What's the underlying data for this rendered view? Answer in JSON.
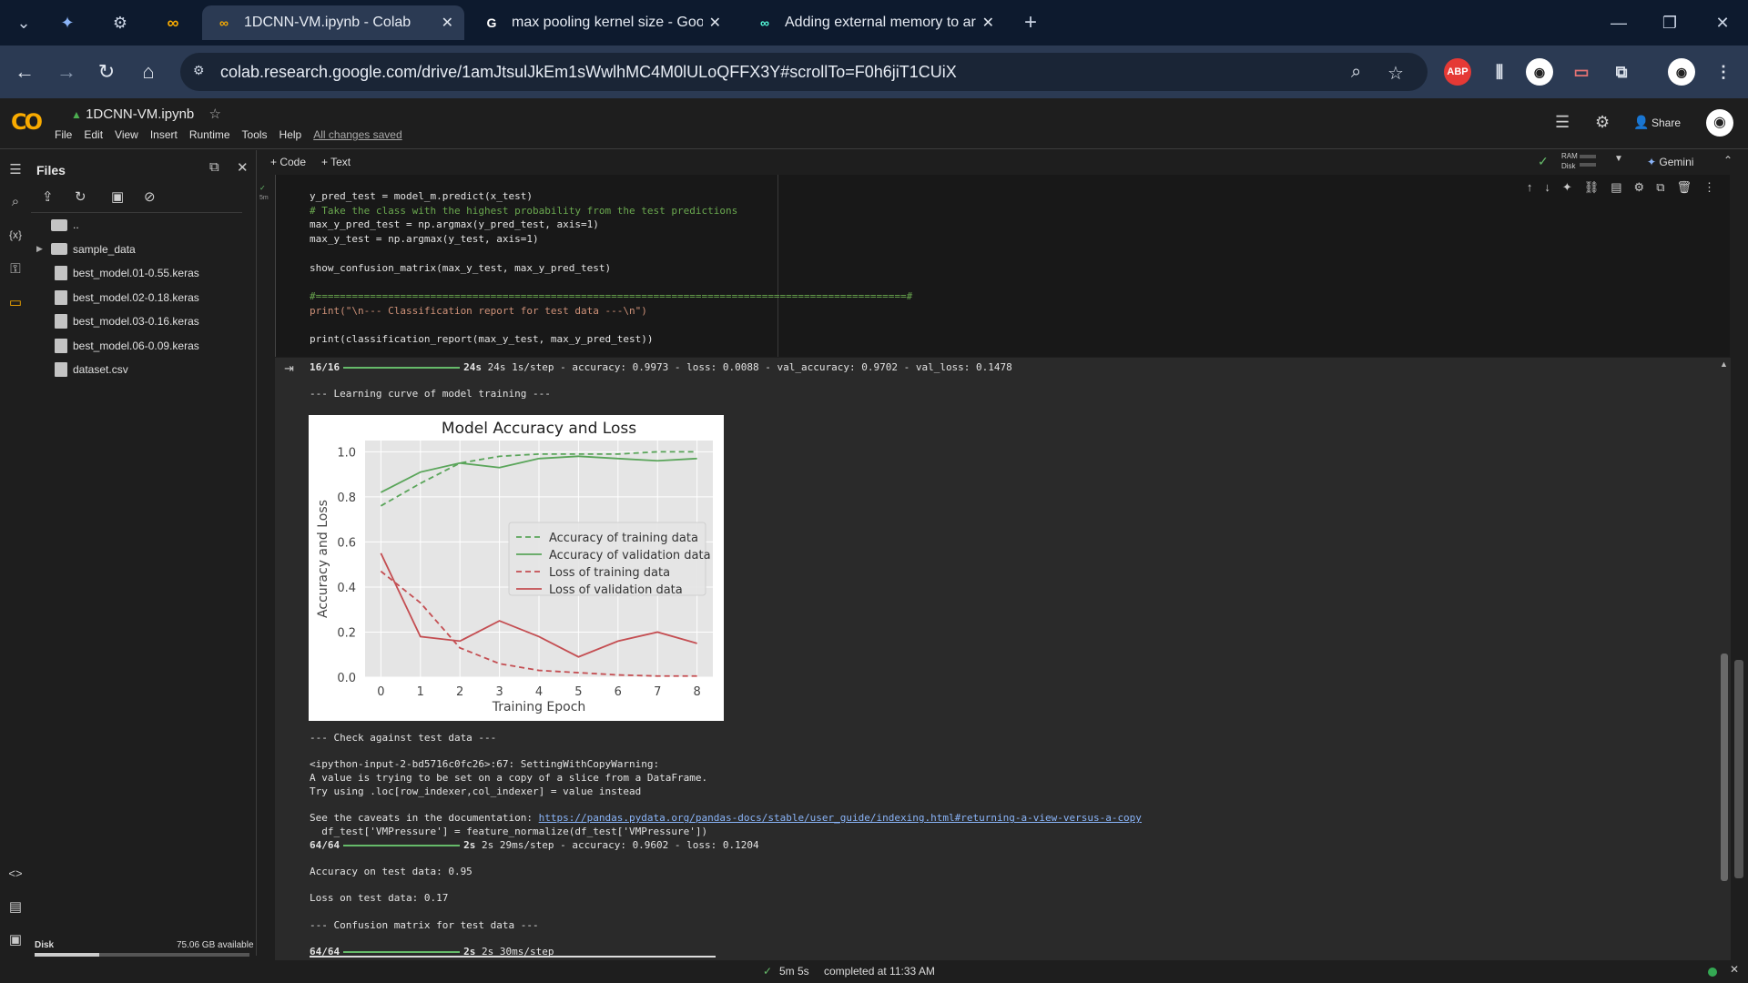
{
  "browser": {
    "tabs": [
      {
        "title": "1DCNN-VM.ipynb - Colab",
        "active": true
      },
      {
        "title": "max pooling kernel size - Goog",
        "active": false
      },
      {
        "title": "Adding external memory to ard",
        "active": false
      }
    ],
    "url": "colab.research.google.com/drive/1amJtsulJkEm1sWwlhMC4M0lULoQFFX3Y#scrollTo=F0h6jiT1CUiX",
    "ext_abp": "ABP"
  },
  "colab": {
    "logo": "CO",
    "notebook_title": "1DCNN-VM.ipynb",
    "menu": [
      "File",
      "Edit",
      "View",
      "Insert",
      "Runtime",
      "Tools",
      "Help"
    ],
    "saved_status": "All changes saved",
    "share_label": "Share",
    "toolbar": {
      "code": "+ Code",
      "text": "+ Text",
      "ram": "RAM",
      "disk": "Disk",
      "gemini": "Gemini"
    }
  },
  "files_panel": {
    "title": "Files",
    "items": [
      {
        "name": "..",
        "type": "folder-up"
      },
      {
        "name": "sample_data",
        "type": "folder"
      },
      {
        "name": "best_model.01-0.55.keras",
        "type": "file"
      },
      {
        "name": "best_model.02-0.18.keras",
        "type": "file"
      },
      {
        "name": "best_model.03-0.16.keras",
        "type": "file"
      },
      {
        "name": "best_model.06-0.09.keras",
        "type": "file"
      },
      {
        "name": "dataset.csv",
        "type": "file"
      }
    ],
    "disk_label": "Disk",
    "disk_available": "75.06 GB available",
    "disk_used_fraction": 0.3
  },
  "cell": {
    "exec_time": "5m",
    "code_lines": [
      "y_pred_test = model_m.predict(x_test)",
      "# Take the class with the highest probability from the test predictions",
      "max_y_pred_test = np.argmax(y_pred_test, axis=1)",
      "max_y_test = np.argmax(y_test, axis=1)",
      "",
      "show_confusion_matrix(max_y_test, max_y_pred_test)",
      "",
      "#==================================================================================================#",
      "print(\"\\n--- Classification report for test data ---\\n\")",
      "",
      "print(classification_report(max_y_test, max_y_pred_test))"
    ]
  },
  "output": {
    "line_epoch_prefix": "16/16",
    "line_epoch_suffix": "24s 1s/step - accuracy: 0.9973 - loss: 0.0088 - val_accuracy: 0.9702 - val_loss: 0.1478",
    "learning_curve_header": "--- Learning curve of model training ---",
    "check_header": "--- Check against test data ---",
    "warning_lines": [
      "<ipython-input-2-bd5716c0fc26>:67: SettingWithCopyWarning:",
      "A value is trying to be set on a copy of a slice from a DataFrame.",
      "Try using .loc[row_indexer,col_indexer] = value instead"
    ],
    "caveat_prefix": "See the caveats in the documentation: ",
    "caveat_link": "https://pandas.pydata.org/pandas-docs/stable/user_guide/indexing.html#returning-a-view-versus-a-copy",
    "df_line": "  df_test['VMPressure'] = feature_normalize(df_test['VMPressure'])",
    "test_progress_prefix": "64/64",
    "test_progress_suffix": "2s 29ms/step - accuracy: 0.9602 - loss: 0.1204",
    "accuracy_line": "Accuracy on test data: 0.95",
    "loss_line": "Loss on test data: 0.17",
    "confusion_header": "--- Confusion matrix for test data ---",
    "last_progress_prefix": "64/64",
    "last_progress_suffix": "2s 30ms/step"
  },
  "status_bar": {
    "elapsed": "5m 5s",
    "completed": "completed at 11:33 AM"
  },
  "chart_data": {
    "type": "line",
    "title": "Model Accuracy and Loss",
    "xlabel": "Training Epoch",
    "ylabel": "Accuracy and Loss",
    "x": [
      0,
      1,
      2,
      3,
      4,
      5,
      6,
      7,
      8
    ],
    "xlim": [
      -0.4,
      8.4
    ],
    "ylim": [
      0,
      1.05
    ],
    "yticks": [
      0.0,
      0.2,
      0.4,
      0.6,
      0.8,
      1.0
    ],
    "legend_position": "center-right",
    "grid": true,
    "series": [
      {
        "name": "Accuracy of training data",
        "color": "#5aa55a",
        "dash": true,
        "values": [
          0.76,
          0.86,
          0.95,
          0.98,
          0.99,
          0.99,
          0.99,
          1.0,
          1.0
        ]
      },
      {
        "name": "Accuracy of validation data",
        "color": "#5aa55a",
        "dash": false,
        "values": [
          0.82,
          0.91,
          0.95,
          0.93,
          0.97,
          0.98,
          0.97,
          0.96,
          0.97
        ]
      },
      {
        "name": "Loss of training data",
        "color": "#c44e52",
        "dash": true,
        "values": [
          0.47,
          0.33,
          0.13,
          0.06,
          0.03,
          0.02,
          0.01,
          0.005,
          0.005
        ]
      },
      {
        "name": "Loss of validation data",
        "color": "#c44e52",
        "dash": false,
        "values": [
          0.55,
          0.18,
          0.16,
          0.25,
          0.18,
          0.09,
          0.16,
          0.2,
          0.15
        ]
      }
    ]
  }
}
